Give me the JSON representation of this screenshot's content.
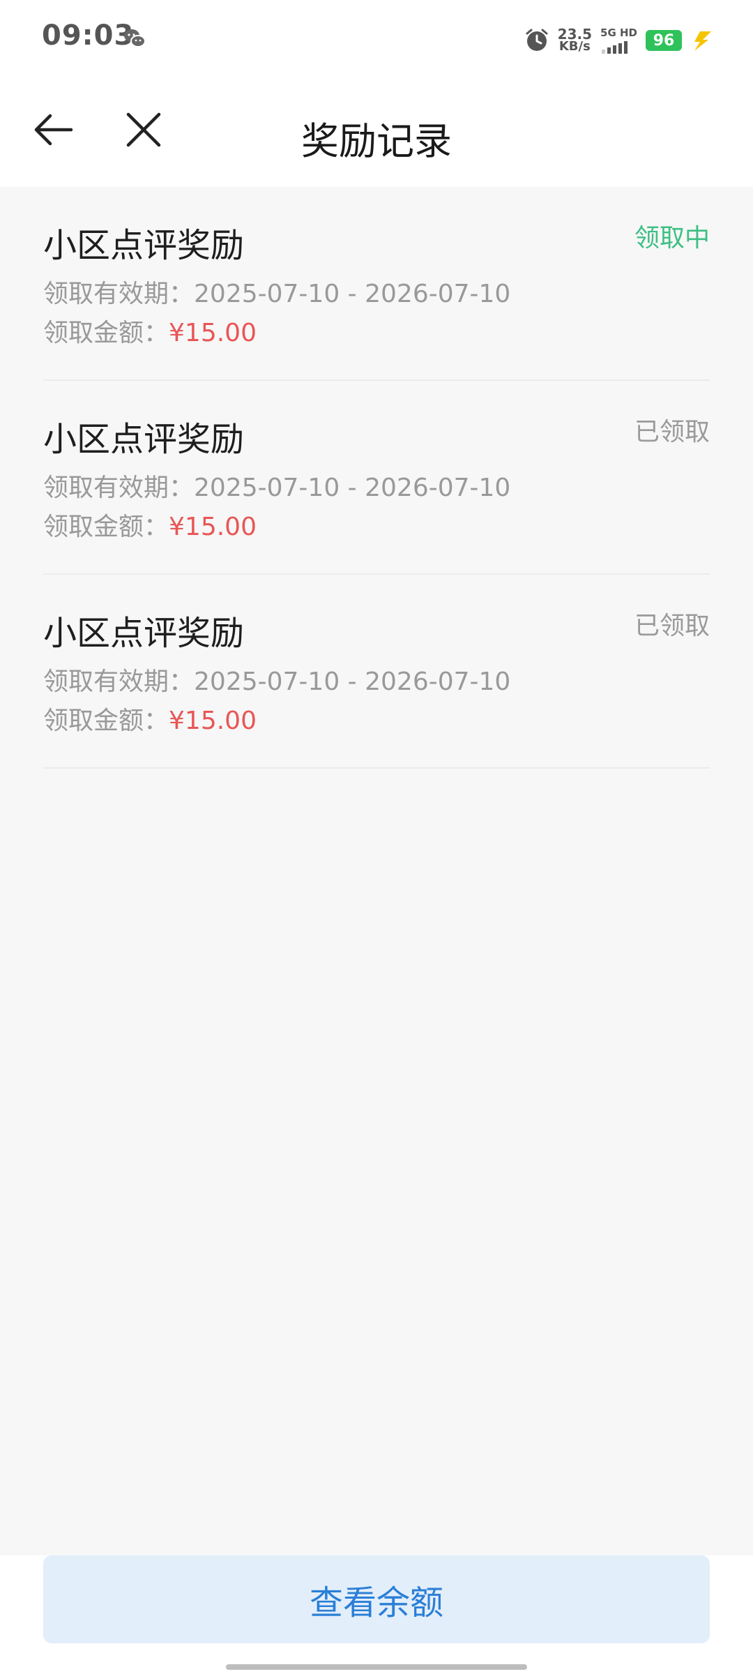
{
  "status_bar": {
    "time": "09:03",
    "network_speed_value": "23.5",
    "network_speed_unit": "KB/s",
    "network_label": "5G HD",
    "battery_level": "96",
    "icons": [
      "wechat-icon",
      "alarm-icon",
      "signal-icon",
      "battery-icon",
      "charging-icon"
    ]
  },
  "nav": {
    "title": "奖励记录",
    "back_icon": "arrow-left-icon",
    "close_icon": "close-icon"
  },
  "records": [
    {
      "title": "小区点评奖励",
      "status": "领取中",
      "validity_label": "领取有效期：",
      "validity_value": "2025-07-10 - 2026-07-10",
      "amount_label": "领取金额：",
      "amount_value": "¥15.00"
    },
    {
      "title": "小区点评奖励",
      "status": "已领取",
      "validity_label": "领取有效期：",
      "validity_value": "2025-07-10 - 2026-07-10",
      "amount_label": "领取金额：",
      "amount_value": "¥15.00"
    },
    {
      "title": "小区点评奖励",
      "status": "已领取",
      "validity_label": "领取有效期：",
      "validity_value": "2025-07-10 - 2026-07-10",
      "amount_label": "领取金额：",
      "amount_value": "¥15.00"
    }
  ],
  "bottom": {
    "button_label": "查看余额"
  },
  "colors": {
    "accent_blue": "#2a7fd6",
    "button_bg": "#e3eefb",
    "status_active": "#3dbf83",
    "status_done": "#9a9a9a",
    "amount_red": "#e85656",
    "battery_green": "#2fc25b"
  }
}
